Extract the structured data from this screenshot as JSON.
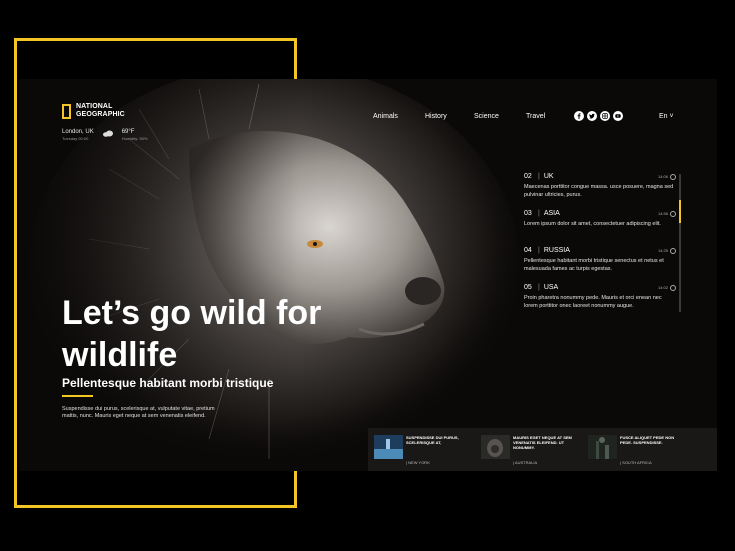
{
  "brand": {
    "line1": "NATIONAL",
    "line2": "GEOGRAPHIC"
  },
  "weather": {
    "city": "London, UK",
    "date": "Tuesday 00:00",
    "temp": "69°F",
    "humidity": "Humidity: 50%",
    "icon": "cloud-icon"
  },
  "nav": {
    "links": [
      "Animals",
      "History",
      "Science",
      "Travel"
    ]
  },
  "social": [
    "facebook-icon",
    "twitter-icon",
    "instagram-icon",
    "youtube-icon"
  ],
  "lang": "En ˅",
  "hero": {
    "title_line1": "Let’s go wild for",
    "title_line2": "wildlife",
    "subtitle": "Pellentesque habitant morbi tristique",
    "description": "Suspendisse dui purus, scelerisque at, vulputate vitae, pretium mattis, nunc. Mauris eget neque at sem venenatis eleifend."
  },
  "timeline": [
    {
      "num": "02",
      "country": "UK",
      "time": "14:06",
      "text": "Maecenas porttitor congue massa. usce posuere, magna sed pulvinar ultricies, purus."
    },
    {
      "num": "03",
      "country": "ASIA",
      "time": "14:56",
      "text": "Lorem ipsum dolor sit amet, consectetuer adipiscing elit."
    },
    {
      "num": "04",
      "country": "RUSSIA",
      "time": "14:25",
      "text": "Pellentesque habitant morbi tristique senectus et netus et malesuada fames ac turpis egestas."
    },
    {
      "num": "05",
      "country": "USA",
      "time": "14:02",
      "text": "Proin pharetra nonummy pede. Mauris et orci enean nec lorem porttitor onec laoreet nonummy augue."
    }
  ],
  "cards": [
    {
      "title": "SUSPENDISSE DUI PURUS, SCELERISQUE AT,",
      "location": "| NEW YORK"
    },
    {
      "title": "MAURIS EGET NEQUE AT SEM VENENATIS ELEIFEND. UT NONUMMY.",
      "location": "| AUSTRALIA"
    },
    {
      "title": "FUSCE ALIQUET PEDE NON PEDE. SUSPENDISSE.",
      "location": "| SOUTH AFRICA"
    }
  ],
  "colors": {
    "accent": "#f3c525",
    "background": "#000000",
    "panel": "#0b0908"
  }
}
